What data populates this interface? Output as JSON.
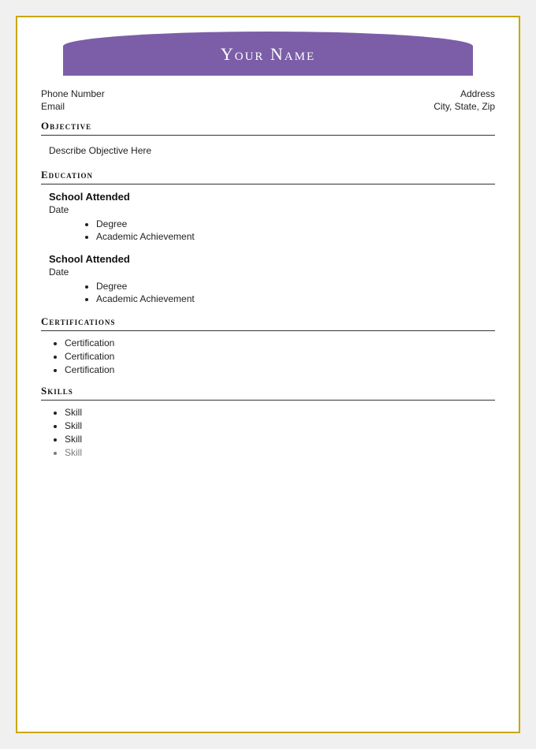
{
  "header": {
    "name": "Your Name"
  },
  "contact": {
    "phone_label": "Phone Number",
    "email_label": "Email",
    "address_label": "Address",
    "city_label": "City, State, Zip"
  },
  "sections": {
    "objective": {
      "heading": "Objective",
      "body": "Describe Objective Here"
    },
    "education": {
      "heading": "Education",
      "schools": [
        {
          "name": "School Attended",
          "date": "Date",
          "items": [
            "Degree",
            "Academic Achievement"
          ]
        },
        {
          "name": "School Attended",
          "date": "Date",
          "items": [
            "Degree",
            "Academic Achievement"
          ]
        }
      ]
    },
    "certifications": {
      "heading": "Certifications",
      "items": [
        "Certification",
        "Certification",
        "Certification"
      ]
    },
    "skills": {
      "heading": "Skills",
      "items": [
        "Skill",
        "Skill",
        "Skill",
        "Skill"
      ]
    }
  }
}
